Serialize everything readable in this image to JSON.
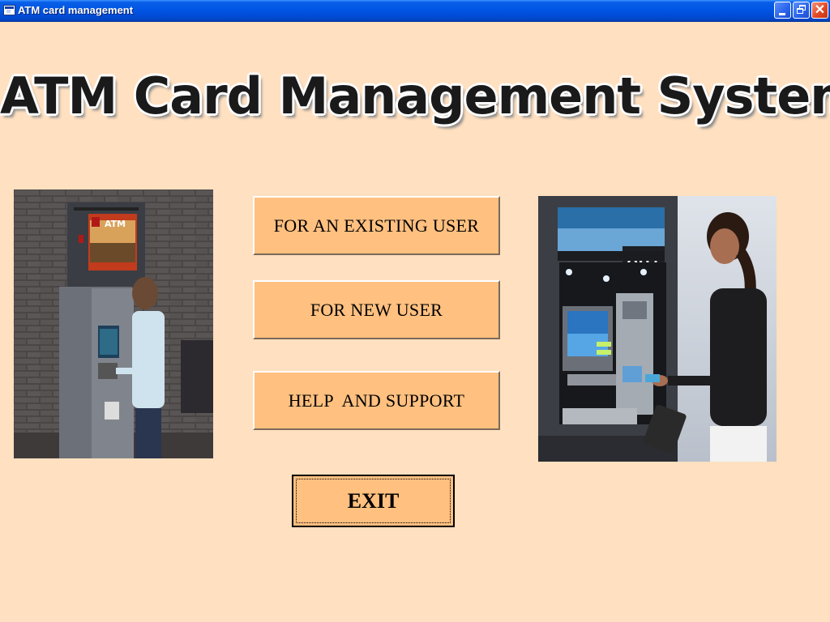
{
  "window": {
    "title": "ATM card management",
    "controls": {
      "minimize_icon": "minimize-icon",
      "maximize_icon": "restore-icon",
      "close_icon": "close-icon"
    }
  },
  "heading": "ATM Card Management System",
  "buttons": {
    "existing_user": "FOR AN EXISTING USER",
    "new_user": "FOR NEW USER",
    "help_support": "HELP  AND SUPPORT",
    "exit": "EXIT"
  },
  "images": {
    "left_photo": {
      "description": "woman-using-atm-brick-wall",
      "atm_sign": "ATM"
    },
    "right_photo": {
      "description": "woman-inserting-card-into-atm",
      "atm_sign": "ATM"
    }
  },
  "colors": {
    "background": "#FFE0C0",
    "button": "#FFC080",
    "titlebar": "#0054E3"
  }
}
